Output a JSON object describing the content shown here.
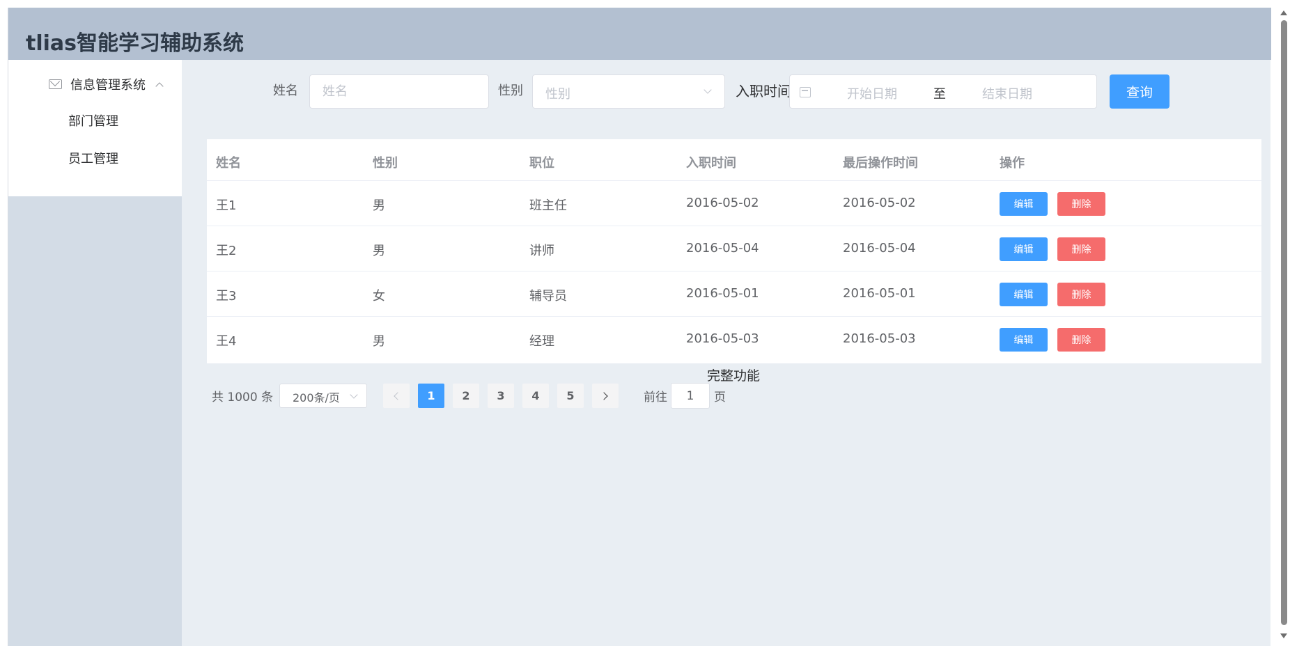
{
  "header": {
    "title": "tlias智能学习辅助系统"
  },
  "sidebar": {
    "group_label": "信息管理系统",
    "items": [
      {
        "label": "部门管理"
      },
      {
        "label": "员工管理"
      }
    ]
  },
  "search": {
    "name_label": "姓名",
    "name_placeholder": "姓名",
    "gender_label": "性别",
    "gender_placeholder": "性别",
    "date_label": "入职时间",
    "start_placeholder": "开始日期",
    "range_separator": "至",
    "end_placeholder": "结束日期",
    "query_button": "查询"
  },
  "table": {
    "columns": [
      "姓名",
      "性别",
      "职位",
      "入职时间",
      "最后操作时间",
      "操作"
    ],
    "rows": [
      {
        "name": "王1",
        "gender": "男",
        "job": "班主任",
        "entry": "2016-05-02",
        "updated": "2016-05-02"
      },
      {
        "name": "王2",
        "gender": "男",
        "job": "讲师",
        "entry": "2016-05-04",
        "updated": "2016-05-04"
      },
      {
        "name": "王3",
        "gender": "女",
        "job": "辅导员",
        "entry": "2016-05-01",
        "updated": "2016-05-01"
      },
      {
        "name": "王4",
        "gender": "男",
        "job": "经理",
        "entry": "2016-05-03",
        "updated": "2016-05-03"
      }
    ],
    "edit_label": "编辑",
    "delete_label": "删除"
  },
  "footer_text": "完整功能",
  "pagination": {
    "total_text": "共 1000 条",
    "page_size": "200条/页",
    "pages": [
      "1",
      "2",
      "3",
      "4",
      "5"
    ],
    "current_page": "1",
    "goto_prefix": "前往",
    "goto_value": "1",
    "goto_suffix": "页"
  },
  "colors": {
    "header_bg": "#b3c0d1",
    "aside_bg": "#d3dce6",
    "main_bg": "#e9eef3",
    "primary": "#409eff",
    "danger": "#f56c6c"
  }
}
